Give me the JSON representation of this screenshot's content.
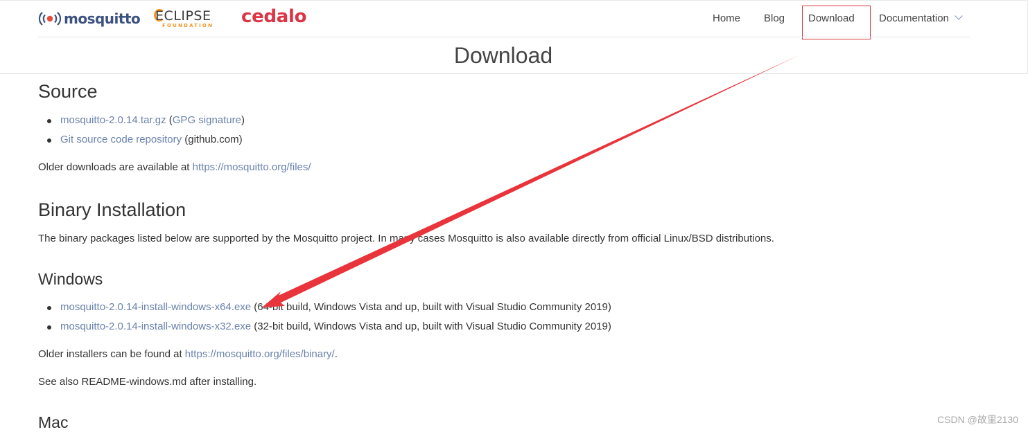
{
  "header": {
    "logo_mosquitto": "mosquitto",
    "logo_eclipse": "ECLIPSE",
    "logo_eclipse_sub": "FOUNDATION",
    "logo_cedalo": "cedalo",
    "nav": {
      "home": "Home",
      "blog": "Blog",
      "download": "Download",
      "documentation": "Documentation"
    }
  },
  "page_title": "Download",
  "source": {
    "heading": "Source",
    "items": [
      {
        "link": "mosquitto-2.0.14.tar.gz",
        "pre": " (",
        "link2": "GPG signature",
        "post": ")"
      },
      {
        "link": "Git source code repository",
        "post": " (github.com)"
      }
    ],
    "older_text": "Older downloads are available at ",
    "older_link": "https://mosquitto.org/files/"
  },
  "binary": {
    "heading": "Binary Installation",
    "text": "The binary packages listed below are supported by the Mosquitto project. In many cases Mosquitto is also available directly from official Linux/BSD distributions."
  },
  "windows": {
    "heading": "Windows",
    "items": [
      {
        "link": "mosquitto-2.0.14-install-windows-x64.exe",
        "post": " (64-bit build, Windows Vista and up, built with Visual Studio Community 2019)"
      },
      {
        "link": "mosquitto-2.0.14-install-windows-x32.exe",
        "post": " (32-bit build, Windows Vista and up, built with Visual Studio Community 2019)"
      }
    ],
    "older_text": "Older installers can be found at ",
    "older_link": "https://mosquitto.org/files/binary/",
    "older_end": ".",
    "readme": "See also README-windows.md after installing."
  },
  "mac": {
    "heading": "Mac"
  },
  "watermark": "CSDN @故里2130",
  "colors": {
    "link": "#6a82ad",
    "annotation": "#e8343a",
    "cedalo": "#dc3545",
    "eclipse_accent": "#f7941e"
  }
}
